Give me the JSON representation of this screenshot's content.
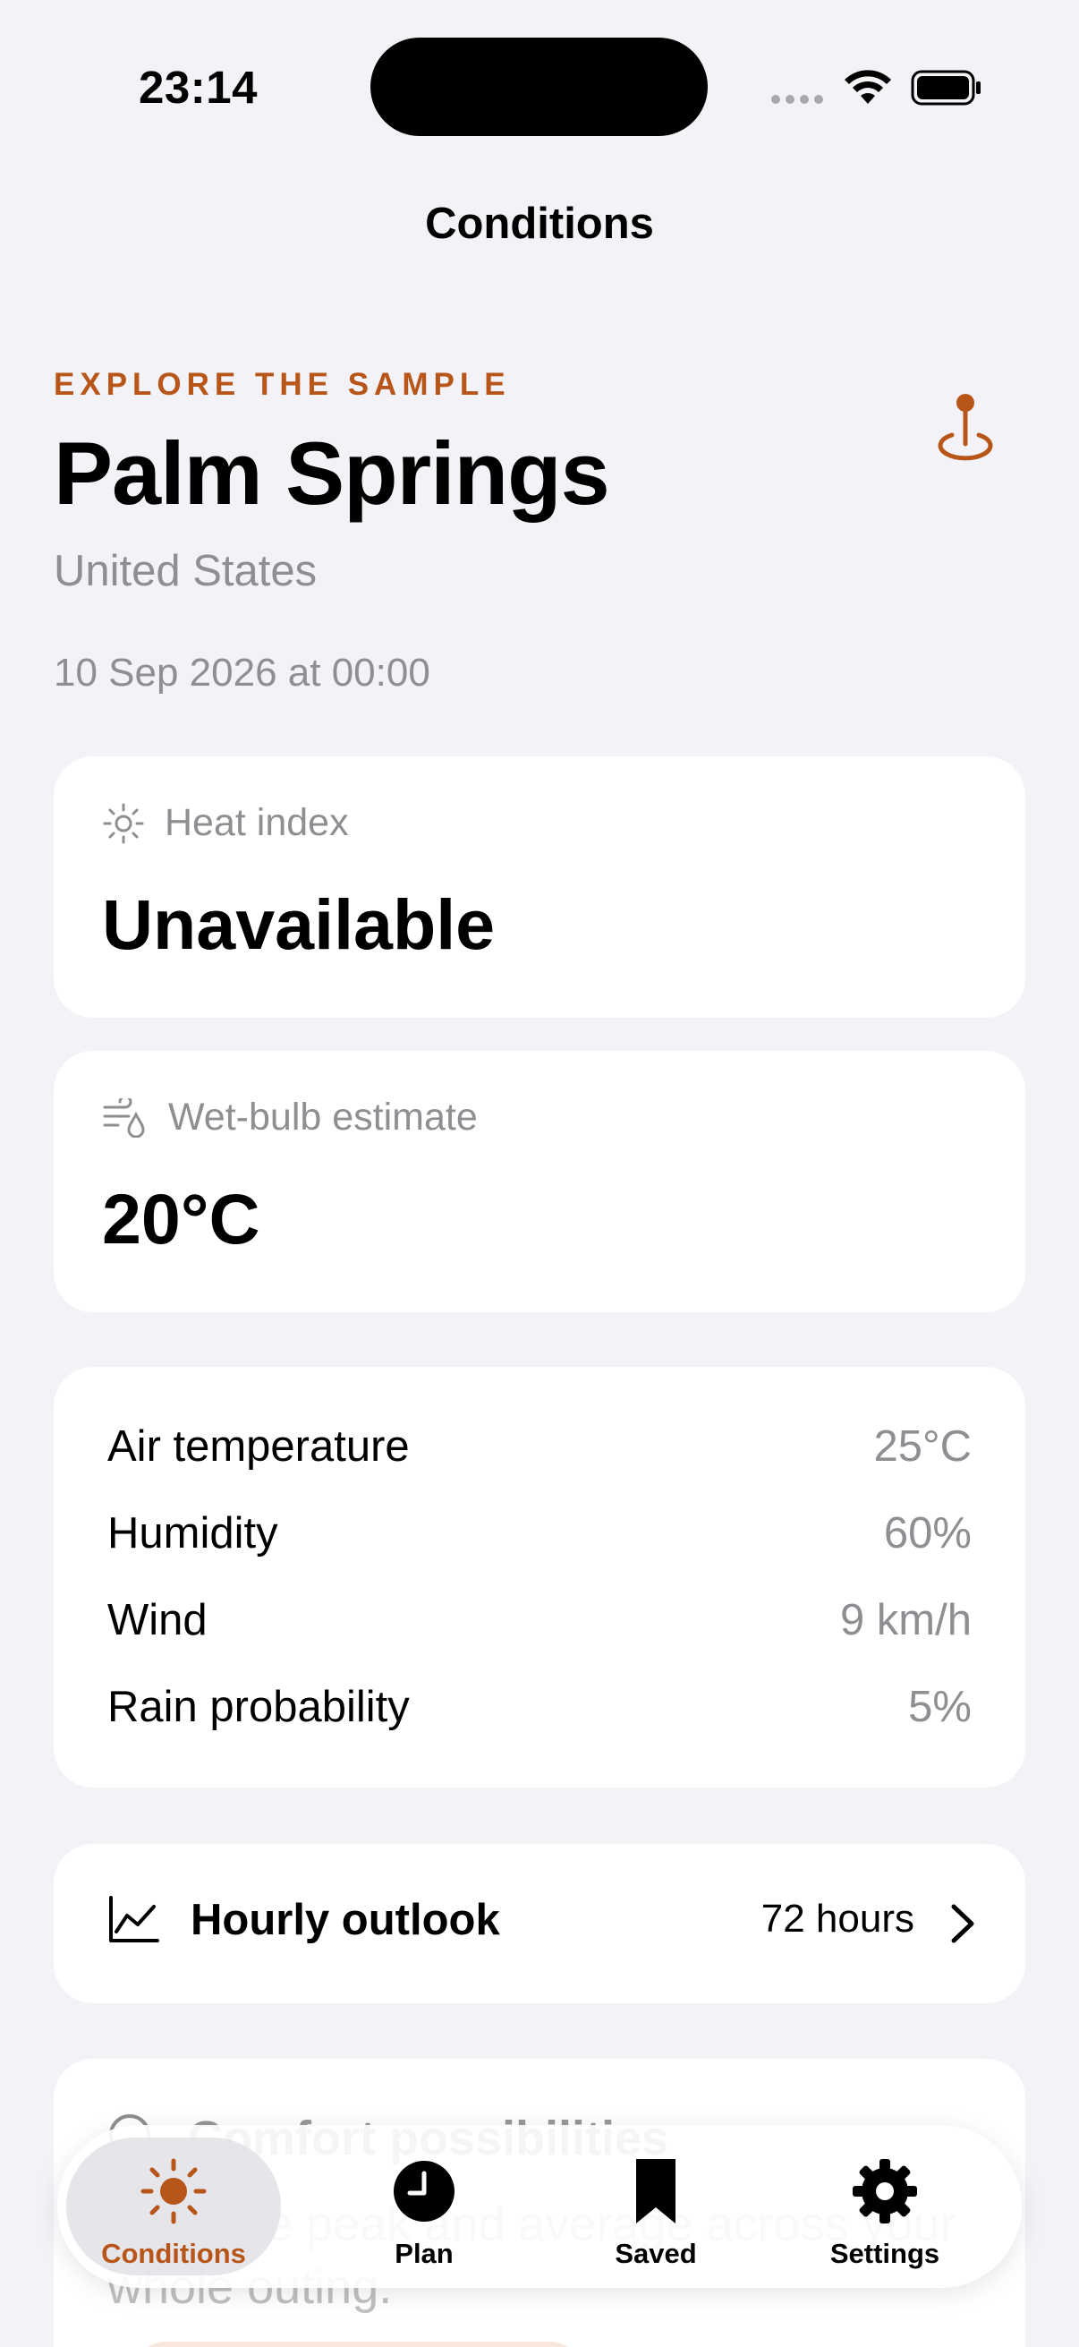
{
  "status_bar": {
    "time": "23:14"
  },
  "nav": {
    "title": "Conditions"
  },
  "header": {
    "eyebrow": "EXPLORE THE SAMPLE",
    "city": "Palm Springs",
    "country": "United States",
    "datetime": "10 Sep 2026 at 00:00",
    "location_icon": "map-pin-icon"
  },
  "heat_index": {
    "label": "Heat index",
    "value": "Unavailable",
    "icon": "sun-icon"
  },
  "wet_bulb": {
    "label": "Wet-bulb estimate",
    "value": "20°C",
    "icon": "wind-droplet-icon"
  },
  "details": [
    {
      "label": "Air temperature",
      "value": "25°C"
    },
    {
      "label": "Humidity",
      "value": "60%"
    },
    {
      "label": "Wind",
      "value": "9 km/h"
    },
    {
      "label": "Rain probability",
      "value": "5%"
    }
  ],
  "hourly": {
    "title": "Hourly outlook",
    "count": "72 hours",
    "icon": "chart-line-icon"
  },
  "next_card": {
    "title": "Comfort possibilities",
    "body": "Light the peak and average across your whole outing."
  },
  "tabs": [
    {
      "label": "Conditions",
      "icon": "sun-icon",
      "selected": true
    },
    {
      "label": "Plan",
      "icon": "clock-icon",
      "selected": false
    },
    {
      "label": "Saved",
      "icon": "bookmark-icon",
      "selected": false
    },
    {
      "label": "Settings",
      "icon": "gear-icon",
      "selected": false
    }
  ],
  "colors": {
    "accent": "#b8561a",
    "background": "#f2f2f7",
    "card": "#ffffff",
    "secondary_text": "#8e8e93"
  }
}
